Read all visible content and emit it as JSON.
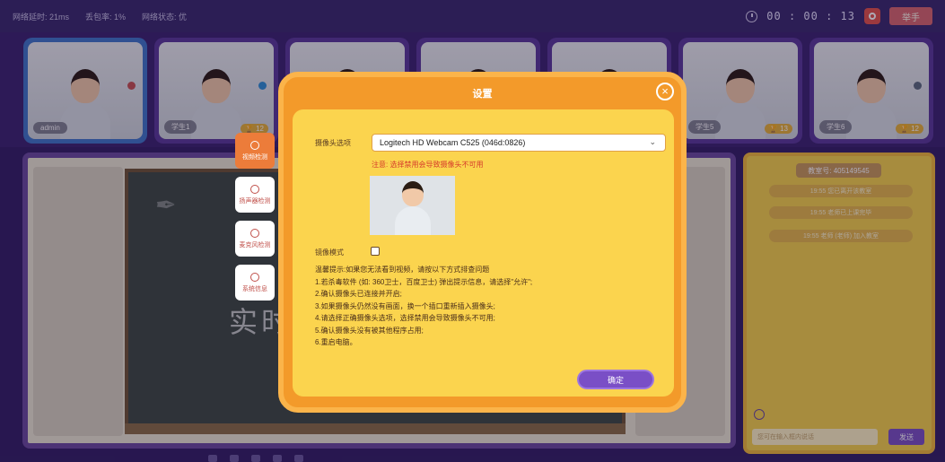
{
  "topbar": {
    "latency": "网络延时: 21ms",
    "loss": "丢包率: 1%",
    "net_status": "网络状态: 优",
    "timer": "00 : 00 : 13",
    "raise_hand": "举手"
  },
  "participants": [
    {
      "name": "admin",
      "mic": "red",
      "trophy": ""
    },
    {
      "name": "学生1",
      "mic": "blue",
      "trophy": "12"
    },
    {
      "name": "",
      "mic": "",
      "trophy": ""
    },
    {
      "name": "",
      "mic": "",
      "trophy": ""
    },
    {
      "name": "",
      "mic": "",
      "trophy": ""
    },
    {
      "name": "学生5",
      "mic": "",
      "trophy": "13"
    },
    {
      "name": "学生6",
      "mic": "grey",
      "trophy": "12"
    }
  ],
  "board": {
    "text": "实时"
  },
  "chat": {
    "room_id": "教室号: 405149545",
    "messages": [
      "19:55 您已离开该教室",
      "19:55 老师已上课完毕",
      "19:55 老师 (老师) 加入教室"
    ],
    "input_placeholder": "您可在输入框内说话",
    "send": "发送"
  },
  "dialog": {
    "title": "设置",
    "tabs": [
      {
        "label": "视频检测",
        "icon": "camera-icon"
      },
      {
        "label": "扬声器检测",
        "icon": "headphones-icon"
      },
      {
        "label": "麦克风检测",
        "icon": "microphone-icon"
      },
      {
        "label": "系统信息",
        "icon": "info-icon"
      }
    ],
    "camera_label": "摄像头选项",
    "camera_value": "Logitech HD Webcam C525 (046d:0826)",
    "camera_warning": "注意: 选择禁用会导致摄像头不可用",
    "mirror_label": "镜像模式",
    "tips": [
      "温馨提示:如果您无法看到视频，请按以下方式排查问题",
      "1.若杀毒软件 (如: 360卫士，百度卫士) 弹出提示信息，请选择\"允许\";",
      "2.确认摄像头已连接并开启;",
      "3.如果摄像头仍然没有画面，换一个插口重新插入摄像头;",
      "4.请选择正确摄像头选项，选择禁用会导致摄像头不可用;",
      "5.确认摄像头没有被其他程序占用;",
      "6.重启电脑。"
    ],
    "ok": "确定"
  }
}
